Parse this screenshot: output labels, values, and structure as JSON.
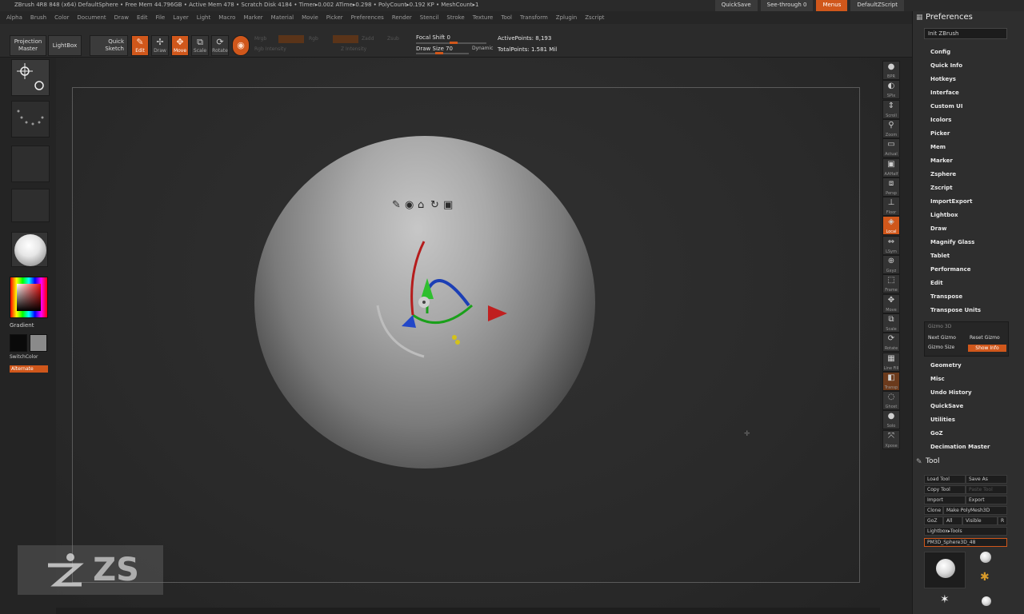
{
  "app": {
    "title": "ZBrush 4R8 848 (x64)   DefaultSphere   • Free Mem 44.796GB • Active Mem 478 • Scratch Disk 4184 • Timer▸0.002 ATime▸0.298 • PolyCount▸0.192 KP • MeshCount▸1"
  },
  "menu": [
    "Alpha",
    "Brush",
    "Color",
    "Document",
    "Draw",
    "Edit",
    "File",
    "Layer",
    "Light",
    "Macro",
    "Marker",
    "Material",
    "Movie",
    "Picker",
    "Preferences",
    "Render",
    "Stencil",
    "Stroke",
    "Texture",
    "Tool",
    "Transform",
    "Zplugin",
    "Zscript"
  ],
  "topright": {
    "quicksave": "QuickSave",
    "seethrough": "See-through  0",
    "menus": "Menus",
    "default_zscript": "DefaultZScript"
  },
  "toolbar": {
    "projection_master": "Projection Master",
    "lightbox": "LightBox",
    "quick_sketch": "Quick Sketch",
    "edit": "Edit",
    "draw": "Draw",
    "move": "Move",
    "scale": "Scale",
    "rotate": "Rotate",
    "focal_shift": "Focal Shift 0",
    "draw_size": "Draw Size 70",
    "dynamic": "Dynamic",
    "active_points": "ActivePoints: 8,193",
    "total_points": "TotalPoints: 1.581 Mil",
    "dim_labels": [
      "Mrgb",
      "Rgb",
      "M",
      "Zadd",
      "Zsub",
      "Zcut",
      "Rgb Intensity",
      "Z Intensity"
    ]
  },
  "left": {
    "gradient": "Gradient",
    "switch_color": "SwitchColor",
    "alternate": "Alternate"
  },
  "right_shelf": [
    "BPR",
    "SPix",
    "Scroll",
    "Zoom",
    "Actual",
    "AAHalf",
    "Persp",
    "Floor",
    "Local",
    "LSym",
    "Gxyz",
    "Frame",
    "Move",
    "Scale",
    "Rotate",
    "Line Fill",
    "Transp",
    "Ghost",
    "Solo",
    "Xpose"
  ],
  "preferences": {
    "title": "Preferences",
    "init": "Init ZBrush",
    "items": [
      "Config",
      "Quick Info",
      "Hotkeys",
      "Interface",
      "Custom UI",
      "Icolors",
      "Picker",
      "Mem",
      "Marker",
      "Zsphere",
      "Zscript",
      "ImportExport",
      "Lightbox",
      "Draw",
      "Magnify Glass",
      "Tablet",
      "Performance",
      "Edit",
      "Transpose",
      "Transpose Units"
    ],
    "gizmo": {
      "group": "Gizmo 3D",
      "next": "Next Gizmo",
      "reset": "Reset Gizmo",
      "size": "Gizmo Size",
      "show_info": "Show Info"
    },
    "items_after": [
      "Geometry",
      "Misc",
      "Undo History",
      "QuickSave",
      "Utilities",
      "GoZ",
      "Decimation Master"
    ]
  },
  "tool": {
    "title": "Tool",
    "load": "Load Tool",
    "save_as": "Save As",
    "copy": "Copy Tool",
    "paste": "Paste Tool",
    "import": "Import",
    "export": "Export",
    "clone": "Clone",
    "make_polymesh": "Make PolyMesh3D",
    "goz": "GoZ",
    "all": "All",
    "visible": "Visible",
    "r": "R",
    "lightbox_tools": "Lightbox▸Tools",
    "current": "PM3D_Sphere3D_48"
  },
  "watermark": "ZS",
  "colors": {
    "accent": "#d0571b",
    "panel": "#2e2e2e",
    "viewport": "#2a2a2a"
  }
}
